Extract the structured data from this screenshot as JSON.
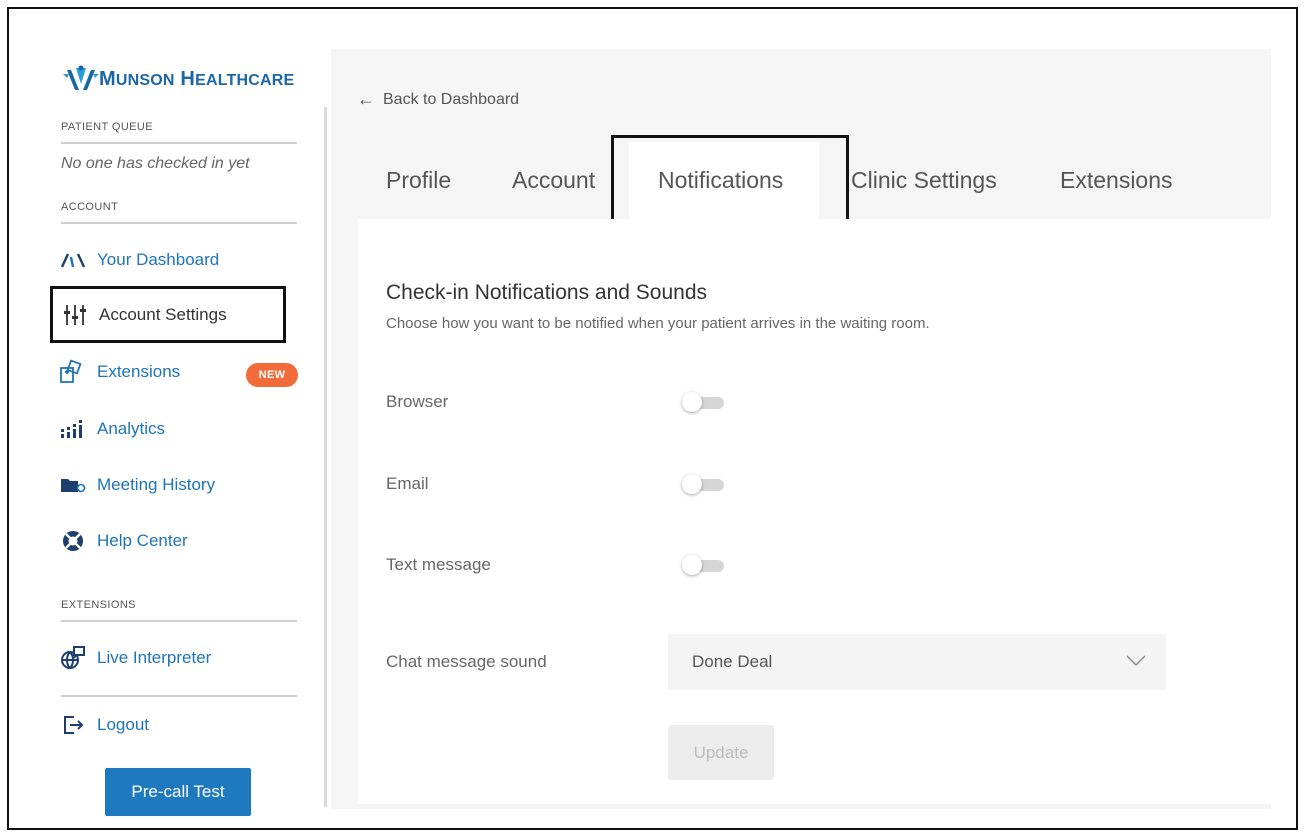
{
  "brand": {
    "name_initial_1": "M",
    "name_rest_1": "UNSON",
    "name_initial_2": "H",
    "name_rest_2": "EALTHCARE",
    "color": "#1a66a7"
  },
  "sidebar": {
    "patient_queue_label": "PATIENT QUEUE",
    "patient_queue_empty": "No one has checked in yet",
    "account_label": "ACCOUNT",
    "items": [
      {
        "label": "Your Dashboard",
        "icon": "gauge-icon"
      },
      {
        "label": "Account Settings",
        "icon": "sliders-icon",
        "active": true
      },
      {
        "label": "Extensions",
        "icon": "puzzle-icon",
        "badge": "NEW"
      },
      {
        "label": "Analytics",
        "icon": "bar-chart-icon"
      },
      {
        "label": "Meeting History",
        "icon": "folder-icon"
      },
      {
        "label": "Help Center",
        "icon": "lifebuoy-icon"
      }
    ],
    "extensions_label": "EXTENSIONS",
    "extension_items": [
      {
        "label": "Live Interpreter",
        "icon": "globe-icon"
      }
    ],
    "logout_label": "Logout",
    "precall_label": "Pre-call Test"
  },
  "main": {
    "back_label": "Back to Dashboard",
    "tabs": [
      {
        "label": "Profile"
      },
      {
        "label": "Account"
      },
      {
        "label": "Notifications",
        "active": true
      },
      {
        "label": "Clinic Settings"
      },
      {
        "label": "Extensions"
      }
    ],
    "section_title": "Check-in Notifications and Sounds",
    "section_subtitle": "Choose how you want to be notified when your patient arrives in the waiting room.",
    "rows": [
      {
        "label": "Browser",
        "enabled": false
      },
      {
        "label": "Email",
        "enabled": false
      },
      {
        "label": "Text message",
        "enabled": false
      }
    ],
    "chat_sound_label": "Chat message sound",
    "chat_sound_value": "Done Deal",
    "update_label": "Update"
  },
  "colors": {
    "accent": "#1d74b9",
    "badge": "#f26b3a",
    "precall": "#1e79bf"
  }
}
